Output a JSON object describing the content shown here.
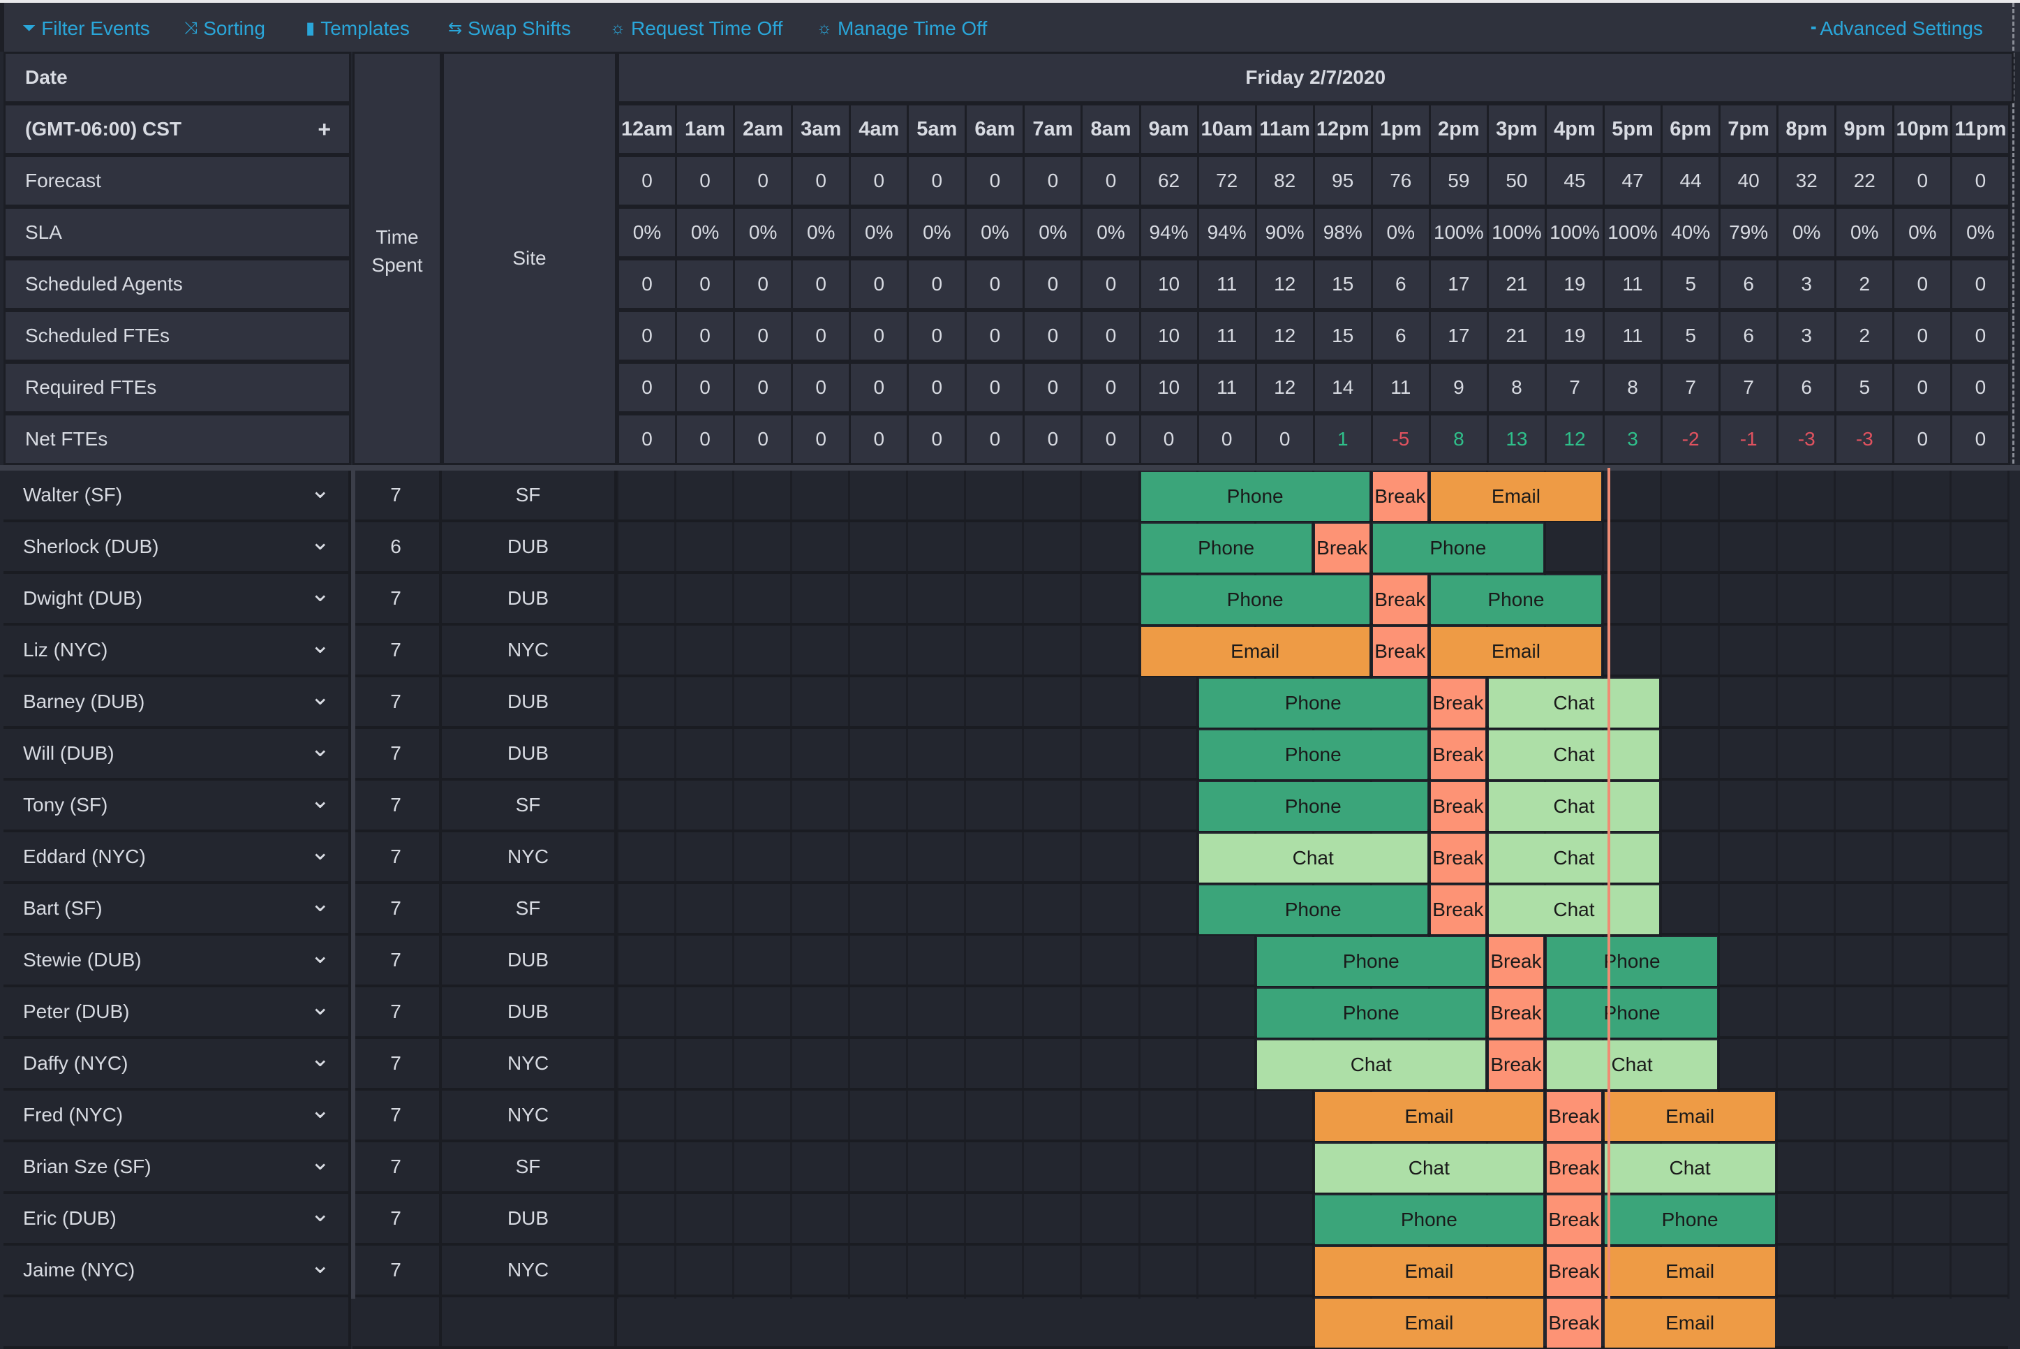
{
  "toolbar": {
    "items": [
      {
        "label": "Filter Events",
        "icon": "filter-icon",
        "glyph": "⏷"
      },
      {
        "label": "Sorting",
        "icon": "shuffle-icon",
        "glyph": "⤨"
      },
      {
        "label": "Templates",
        "icon": "book-icon",
        "glyph": "▮"
      },
      {
        "label": "Swap Shifts",
        "icon": "swap-icon",
        "glyph": "⇆"
      },
      {
        "label": "Request Time Off",
        "icon": "sun-icon",
        "glyph": "☼"
      },
      {
        "label": "Manage Time Off",
        "icon": "sun-icon",
        "glyph": "☼"
      }
    ],
    "advanced": {
      "label": "Advanced Settings",
      "icon": "grid-icon",
      "glyph": "▪▪"
    }
  },
  "header": {
    "date_label": "Date",
    "timezone": "(GMT-06:00) CST",
    "add_glyph": "+",
    "time_spent_label": "Time Spent",
    "site_label": "Site",
    "day_title": "Friday 2/7/2020",
    "hours": [
      "12am",
      "1am",
      "2am",
      "3am",
      "4am",
      "5am",
      "6am",
      "7am",
      "8am",
      "9am",
      "10am",
      "11am",
      "12pm",
      "1pm",
      "2pm",
      "3pm",
      "4pm",
      "5pm",
      "6pm",
      "7pm",
      "8pm",
      "9pm",
      "10pm",
      "11pm"
    ]
  },
  "metrics": [
    {
      "label": "Forecast",
      "values": [
        "0",
        "0",
        "0",
        "0",
        "0",
        "0",
        "0",
        "0",
        "0",
        "62",
        "72",
        "82",
        "95",
        "76",
        "59",
        "50",
        "45",
        "47",
        "44",
        "40",
        "32",
        "22",
        "0",
        "0"
      ]
    },
    {
      "label": "SLA",
      "values": [
        "0%",
        "0%",
        "0%",
        "0%",
        "0%",
        "0%",
        "0%",
        "0%",
        "0%",
        "94%",
        "94%",
        "90%",
        "98%",
        "0%",
        "100%",
        "100%",
        "100%",
        "100%",
        "40%",
        "79%",
        "0%",
        "0%",
        "0%",
        "0%"
      ]
    },
    {
      "label": "Scheduled Agents",
      "values": [
        "0",
        "0",
        "0",
        "0",
        "0",
        "0",
        "0",
        "0",
        "0",
        "10",
        "11",
        "12",
        "15",
        "6",
        "17",
        "21",
        "19",
        "11",
        "5",
        "6",
        "3",
        "2",
        "0",
        "0"
      ]
    },
    {
      "label": "Scheduled FTEs",
      "values": [
        "0",
        "0",
        "0",
        "0",
        "0",
        "0",
        "0",
        "0",
        "0",
        "10",
        "11",
        "12",
        "15",
        "6",
        "17",
        "21",
        "19",
        "11",
        "5",
        "6",
        "3",
        "2",
        "0",
        "0"
      ]
    },
    {
      "label": "Required FTEs",
      "values": [
        "0",
        "0",
        "0",
        "0",
        "0",
        "0",
        "0",
        "0",
        "0",
        "10",
        "11",
        "12",
        "14",
        "11",
        "9",
        "8",
        "7",
        "8",
        "7",
        "7",
        "6",
        "5",
        "0",
        "0"
      ]
    },
    {
      "label": "Net FTEs",
      "values": [
        "0",
        "0",
        "0",
        "0",
        "0",
        "0",
        "0",
        "0",
        "0",
        "0",
        "0",
        "0",
        "1",
        "-5",
        "8",
        "13",
        "12",
        "3",
        "-2",
        "-1",
        "-3",
        "-3",
        "0",
        "0"
      ],
      "signed": true
    }
  ],
  "activity_colors": {
    "Phone": "#3ba57a",
    "Break": "#fd9375",
    "Email": "#ee9b45",
    "Chat": "#addfa7"
  },
  "current_time_hour": 17.08,
  "agents": [
    {
      "name": "Walter (SF)",
      "time_spent": "7",
      "site": "SF",
      "shifts": [
        {
          "activity": "Phone",
          "start": 9,
          "end": 13
        },
        {
          "activity": "Break",
          "start": 13,
          "end": 14
        },
        {
          "activity": "Email",
          "start": 14,
          "end": 17
        }
      ]
    },
    {
      "name": "Sherlock (DUB)",
      "time_spent": "6",
      "site": "DUB",
      "shifts": [
        {
          "activity": "Phone",
          "start": 9,
          "end": 12
        },
        {
          "activity": "Break",
          "start": 12,
          "end": 13
        },
        {
          "activity": "Phone",
          "start": 13,
          "end": 16
        }
      ]
    },
    {
      "name": "Dwight (DUB)",
      "time_spent": "7",
      "site": "DUB",
      "shifts": [
        {
          "activity": "Phone",
          "start": 9,
          "end": 13
        },
        {
          "activity": "Break",
          "start": 13,
          "end": 14
        },
        {
          "activity": "Phone",
          "start": 14,
          "end": 17
        }
      ]
    },
    {
      "name": "Liz (NYC)",
      "time_spent": "7",
      "site": "NYC",
      "shifts": [
        {
          "activity": "Email",
          "start": 9,
          "end": 13
        },
        {
          "activity": "Break",
          "start": 13,
          "end": 14
        },
        {
          "activity": "Email",
          "start": 14,
          "end": 17
        }
      ]
    },
    {
      "name": "Barney (DUB)",
      "time_spent": "7",
      "site": "DUB",
      "shifts": [
        {
          "activity": "Phone",
          "start": 10,
          "end": 14
        },
        {
          "activity": "Break",
          "start": 14,
          "end": 15
        },
        {
          "activity": "Chat",
          "start": 15,
          "end": 18
        }
      ]
    },
    {
      "name": "Will (DUB)",
      "time_spent": "7",
      "site": "DUB",
      "shifts": [
        {
          "activity": "Phone",
          "start": 10,
          "end": 14
        },
        {
          "activity": "Break",
          "start": 14,
          "end": 15
        },
        {
          "activity": "Chat",
          "start": 15,
          "end": 18
        }
      ]
    },
    {
      "name": "Tony (SF)",
      "time_spent": "7",
      "site": "SF",
      "shifts": [
        {
          "activity": "Phone",
          "start": 10,
          "end": 14
        },
        {
          "activity": "Break",
          "start": 14,
          "end": 15
        },
        {
          "activity": "Chat",
          "start": 15,
          "end": 18
        }
      ]
    },
    {
      "name": "Eddard (NYC)",
      "time_spent": "7",
      "site": "NYC",
      "shifts": [
        {
          "activity": "Chat",
          "start": 10,
          "end": 14
        },
        {
          "activity": "Break",
          "start": 14,
          "end": 15
        },
        {
          "activity": "Chat",
          "start": 15,
          "end": 18
        }
      ]
    },
    {
      "name": "Bart (SF)",
      "time_spent": "7",
      "site": "SF",
      "shifts": [
        {
          "activity": "Phone",
          "start": 10,
          "end": 14
        },
        {
          "activity": "Break",
          "start": 14,
          "end": 15
        },
        {
          "activity": "Chat",
          "start": 15,
          "end": 18
        }
      ]
    },
    {
      "name": "Stewie (DUB)",
      "time_spent": "7",
      "site": "DUB",
      "shifts": [
        {
          "activity": "Phone",
          "start": 11,
          "end": 15
        },
        {
          "activity": "Break",
          "start": 15,
          "end": 16
        },
        {
          "activity": "Phone",
          "start": 16,
          "end": 19
        }
      ]
    },
    {
      "name": "Peter (DUB)",
      "time_spent": "7",
      "site": "DUB",
      "shifts": [
        {
          "activity": "Phone",
          "start": 11,
          "end": 15
        },
        {
          "activity": "Break",
          "start": 15,
          "end": 16
        },
        {
          "activity": "Phone",
          "start": 16,
          "end": 19
        }
      ]
    },
    {
      "name": "Daffy (NYC)",
      "time_spent": "7",
      "site": "NYC",
      "shifts": [
        {
          "activity": "Chat",
          "start": 11,
          "end": 15
        },
        {
          "activity": "Break",
          "start": 15,
          "end": 16
        },
        {
          "activity": "Chat",
          "start": 16,
          "end": 19
        }
      ]
    },
    {
      "name": "Fred (NYC)",
      "time_spent": "7",
      "site": "NYC",
      "shifts": [
        {
          "activity": "Email",
          "start": 12,
          "end": 16
        },
        {
          "activity": "Break",
          "start": 16,
          "end": 17
        },
        {
          "activity": "Email",
          "start": 17,
          "end": 20
        }
      ]
    },
    {
      "name": "Brian Sze (SF)",
      "time_spent": "7",
      "site": "SF",
      "shifts": [
        {
          "activity": "Chat",
          "start": 12,
          "end": 16
        },
        {
          "activity": "Break",
          "start": 16,
          "end": 17
        },
        {
          "activity": "Chat",
          "start": 17,
          "end": 20
        }
      ]
    },
    {
      "name": "Eric (DUB)",
      "time_spent": "7",
      "site": "DUB",
      "shifts": [
        {
          "activity": "Phone",
          "start": 12,
          "end": 16
        },
        {
          "activity": "Break",
          "start": 16,
          "end": 17
        },
        {
          "activity": "Phone",
          "start": 17,
          "end": 20
        }
      ]
    },
    {
      "name": "Jaime (NYC)",
      "time_spent": "7",
      "site": "NYC",
      "shifts": [
        {
          "activity": "Email",
          "start": 12,
          "end": 16
        },
        {
          "activity": "Break",
          "start": 16,
          "end": 17
        },
        {
          "activity": "Email",
          "start": 17,
          "end": 20
        }
      ]
    },
    {
      "name": "",
      "time_spent": "",
      "site": "",
      "shifts": [
        {
          "activity": "Email",
          "start": 12,
          "end": 16
        },
        {
          "activity": "Break",
          "start": 16,
          "end": 17
        },
        {
          "activity": "Email",
          "start": 17,
          "end": 20
        }
      ]
    }
  ]
}
